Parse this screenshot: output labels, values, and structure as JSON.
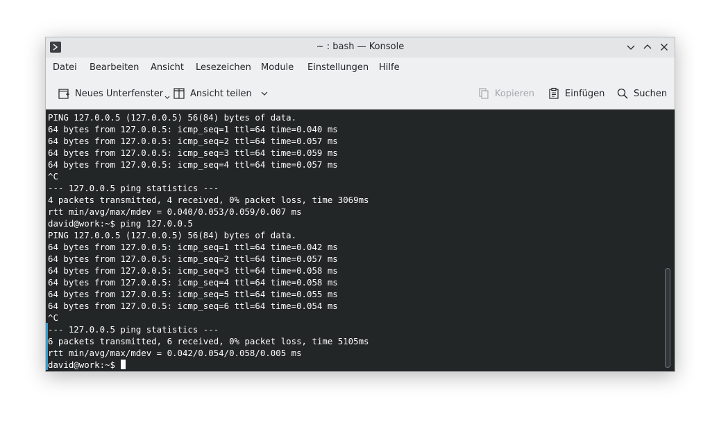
{
  "window": {
    "title": "~ : bash — Konsole"
  },
  "menubar": {
    "items": [
      "Datei",
      "Bearbeiten",
      "Ansicht",
      "Lesezeichen",
      "Module",
      "Einstellungen",
      "Hilfe"
    ]
  },
  "toolbar": {
    "new_tab": "Neues Unterfenster",
    "split_view": "Ansicht teilen",
    "copy": "Kopieren",
    "paste": "Einfügen",
    "search": "Suchen"
  },
  "terminal": {
    "lines": [
      "PING 127.0.0.5 (127.0.0.5) 56(84) bytes of data.",
      "64 bytes from 127.0.0.5: icmp_seq=1 ttl=64 time=0.040 ms",
      "64 bytes from 127.0.0.5: icmp_seq=2 ttl=64 time=0.057 ms",
      "64 bytes from 127.0.0.5: icmp_seq=3 ttl=64 time=0.059 ms",
      "64 bytes from 127.0.0.5: icmp_seq=4 ttl=64 time=0.057 ms",
      "^C",
      "--- 127.0.0.5 ping statistics ---",
      "4 packets transmitted, 4 received, 0% packet loss, time 3069ms",
      "rtt min/avg/max/mdev = 0.040/0.053/0.059/0.007 ms",
      "david@work:~$ ping 127.0.0.5",
      "PING 127.0.0.5 (127.0.0.5) 56(84) bytes of data.",
      "64 bytes from 127.0.0.5: icmp_seq=1 ttl=64 time=0.042 ms",
      "64 bytes from 127.0.0.5: icmp_seq=2 ttl=64 time=0.057 ms",
      "64 bytes from 127.0.0.5: icmp_seq=3 ttl=64 time=0.058 ms",
      "64 bytes from 127.0.0.5: icmp_seq=4 ttl=64 time=0.058 ms",
      "64 bytes from 127.0.0.5: icmp_seq=5 ttl=64 time=0.055 ms",
      "64 bytes from 127.0.0.5: icmp_seq=6 ttl=64 time=0.054 ms",
      "^C",
      "--- 127.0.0.5 ping statistics ---",
      "6 packets transmitted, 6 received, 0% packet loss, time 5105ms",
      "rtt min/avg/max/mdev = 0.042/0.054/0.058/0.005 ms"
    ],
    "prompt": "david@work:~$ "
  },
  "colors": {
    "terminal_bg": "#232627",
    "terminal_fg": "#fcfcfc",
    "accent": "#3daee9"
  }
}
